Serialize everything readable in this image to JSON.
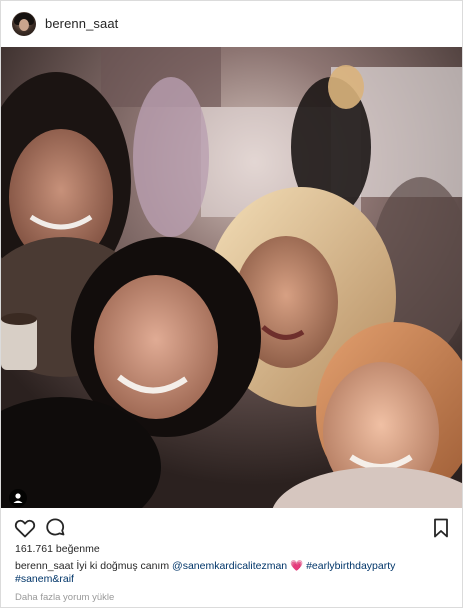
{
  "header": {
    "username": "berenn_saat"
  },
  "post": {
    "likes_count": "161.761",
    "likes_label": "beğenme",
    "caption": {
      "username": "berenn_saat",
      "text": "İyi ki doğmuş canım",
      "mention": "@sanemkardicalitezman",
      "emoji": "💗",
      "hashtag1": "#earlybirthdayparty",
      "hashtag2": "#sanem&raif"
    },
    "more_comments": "Daha fazla yorum yükle"
  },
  "icons": {
    "like": "heart-icon",
    "comment": "comment-icon",
    "save": "bookmark-icon",
    "tag": "user-tag-icon"
  },
  "colors": {
    "text": "#262626",
    "link": "#003569",
    "muted": "#999999",
    "border": "#dbdbdb"
  }
}
